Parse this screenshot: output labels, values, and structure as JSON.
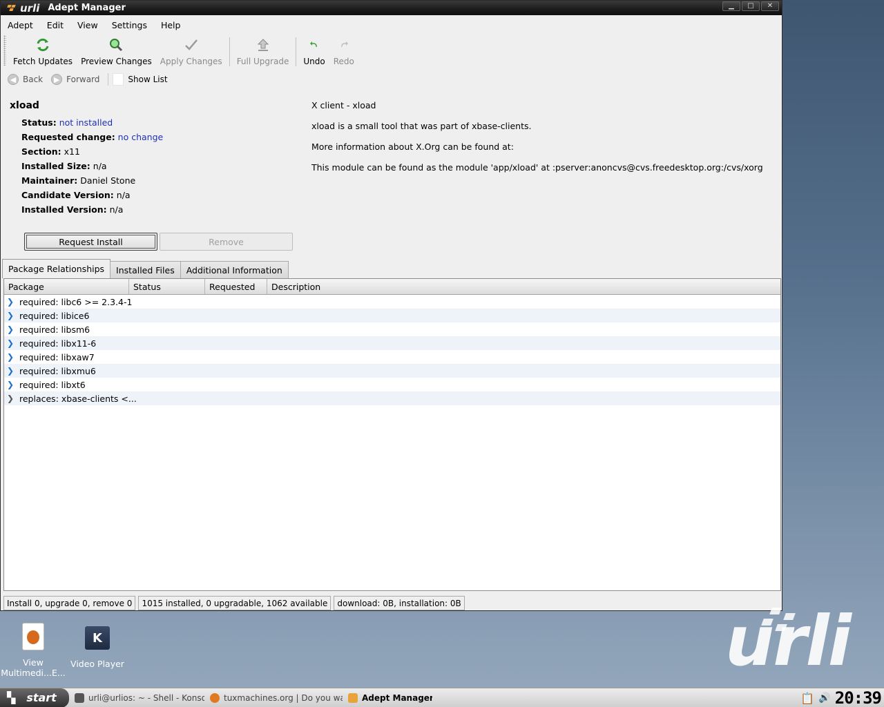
{
  "window": {
    "title": "Adept Manager",
    "wm_brand": "urli"
  },
  "menu": [
    "Adept",
    "Edit",
    "View",
    "Settings",
    "Help"
  ],
  "toolbar": {
    "fetch": "Fetch Updates",
    "preview": "Preview Changes",
    "apply": "Apply Changes",
    "full_upgrade": "Full Upgrade",
    "undo": "Undo",
    "redo": "Redo"
  },
  "nav": {
    "back": "Back",
    "forward": "Forward",
    "show_list": "Show List"
  },
  "package": {
    "name": "xload",
    "status_label": "Status:",
    "status": "not installed",
    "req_label": "Requested change:",
    "req": "no change",
    "section_label": "Section:",
    "section": "x11",
    "isize_label": "Installed Size:",
    "isize": "n/a",
    "maint_label": "Maintainer:",
    "maint": "Daniel Stone",
    "cand_label": "Candidate Version:",
    "cand": "n/a",
    "inst_label": "Installed Version:",
    "inst": "n/a"
  },
  "description": [
    "X client - xload",
    "xload is a small tool that was part of xbase-clients.",
    "More information about X.Org can be found at:",
    "This module can be found as the module 'app/xload' at :pserver:anoncvs@cvs.freedesktop.org:/cvs/xorg"
  ],
  "actions": {
    "install": "Request Install",
    "remove": "Remove"
  },
  "tabs": [
    "Package Relationships",
    "Installed Files",
    "Additional Information"
  ],
  "columns": [
    "Package",
    "Status",
    "Requested",
    "Description"
  ],
  "rows": [
    "required: libc6 >= 2.3.4-1",
    "required: libice6",
    "required: libsm6",
    "required: libx11-6",
    "required: libxaw7",
    "required: libxmu6",
    "required: libxt6",
    "replaces: xbase-clients <..."
  ],
  "statusbar": [
    "Install 0, upgrade 0, remove 0",
    "1015 installed, 0 upgradable, 1062 available",
    "download: 0B, installation: 0B"
  ],
  "desktop": {
    "icon1_line1": "View",
    "icon1_line2": "Multimedi...E...",
    "icon2": "Video Player",
    "brand": "urli"
  },
  "taskbar": {
    "start": "start",
    "tasks": [
      "urli@urlios: ~ - Shell - Konsole",
      "tuxmachines.org | Do you wadd",
      "Adept Manager"
    ],
    "clock": "20:39"
  },
  "colors": {
    "link": "#1f2fb5",
    "row_alt": "#eef3f9"
  }
}
